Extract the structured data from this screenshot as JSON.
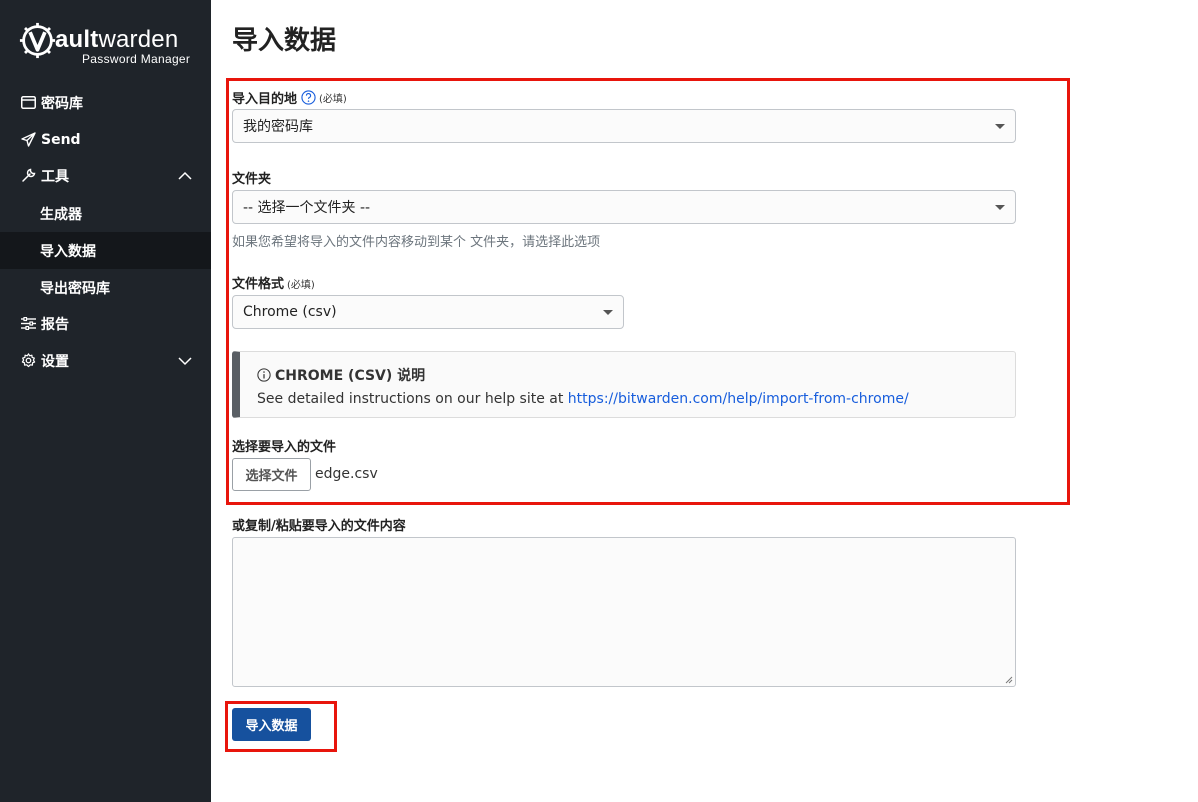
{
  "app": {
    "logo_word_light": "V",
    "logo_word_bold": "ault",
    "logo_word_rest": "warden",
    "logo_sub": "Password Manager"
  },
  "sidebar": {
    "items": [
      {
        "label": "密码库",
        "icon": "vault-icon"
      },
      {
        "label": "Send",
        "icon": "send-icon"
      },
      {
        "label": "工具",
        "icon": "wrench-icon",
        "expanded": true
      },
      {
        "label": "报告",
        "icon": "reports-icon"
      },
      {
        "label": "设置",
        "icon": "gear-icon",
        "expanded": false
      }
    ],
    "tools_sub": [
      {
        "label": "生成器"
      },
      {
        "label": "导入数据",
        "active": true
      },
      {
        "label": "导出密码库"
      }
    ]
  },
  "page": {
    "title": "导入数据"
  },
  "form": {
    "destination_label": "导入目的地",
    "required_tag": "(必填)",
    "destination_value": "我的密码库",
    "folder_label": "文件夹",
    "folder_value": "-- 选择一个文件夹 --",
    "folder_hint": "如果您希望将导入的文件内容移动到某个 文件夹，请选择此选项",
    "format_label": "文件格式",
    "format_value": "Chrome (csv)",
    "callout_title": "CHROME (CSV) 说明",
    "callout_body": "See detailed instructions on our help site at ",
    "callout_link": "https://bitwarden.com/help/import-from-chrome/",
    "file_label": "选择要导入的文件",
    "file_button": "选择文件",
    "file_name": "edge.csv",
    "paste_label": "或复制/粘贴要导入的文件内容",
    "submit_label": "导入数据"
  },
  "colors": {
    "sidebar_bg": "#1f242a",
    "accent": "#16519e",
    "link": "#175ddc",
    "highlight": "#e8150c"
  }
}
